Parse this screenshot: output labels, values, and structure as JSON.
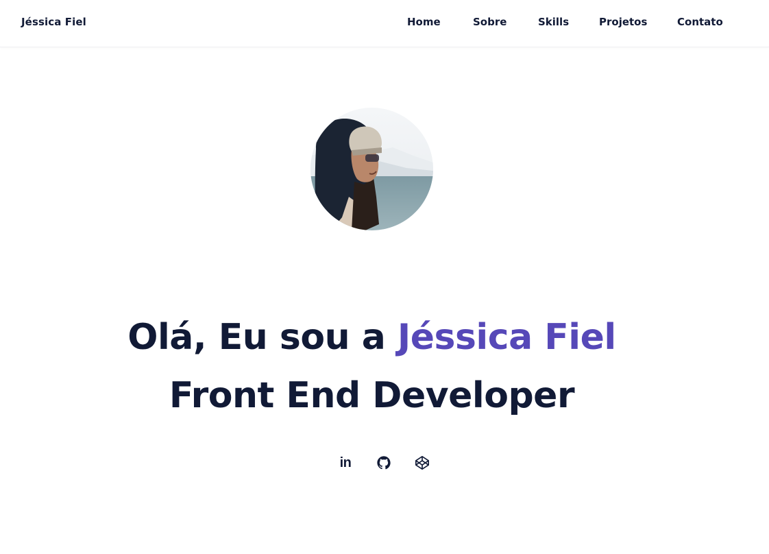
{
  "header": {
    "brand": "Jéssica Fiel",
    "nav": [
      "Home",
      "Sobre",
      "Skills",
      "Projetos",
      "Contato"
    ]
  },
  "hero": {
    "avatar_alt": "Jéssica Fiel",
    "greeting_prefix": "Olá, Eu sou a ",
    "greeting_name": "Jéssica Fiel",
    "role": "Front End Developer"
  },
  "socials": [
    {
      "name": "linkedin-icon",
      "label": "in"
    },
    {
      "name": "github-icon"
    },
    {
      "name": "codepen-icon"
    }
  ],
  "colors": {
    "text": "#111a36",
    "accent": "#5648b8",
    "background": "#ffffff"
  }
}
